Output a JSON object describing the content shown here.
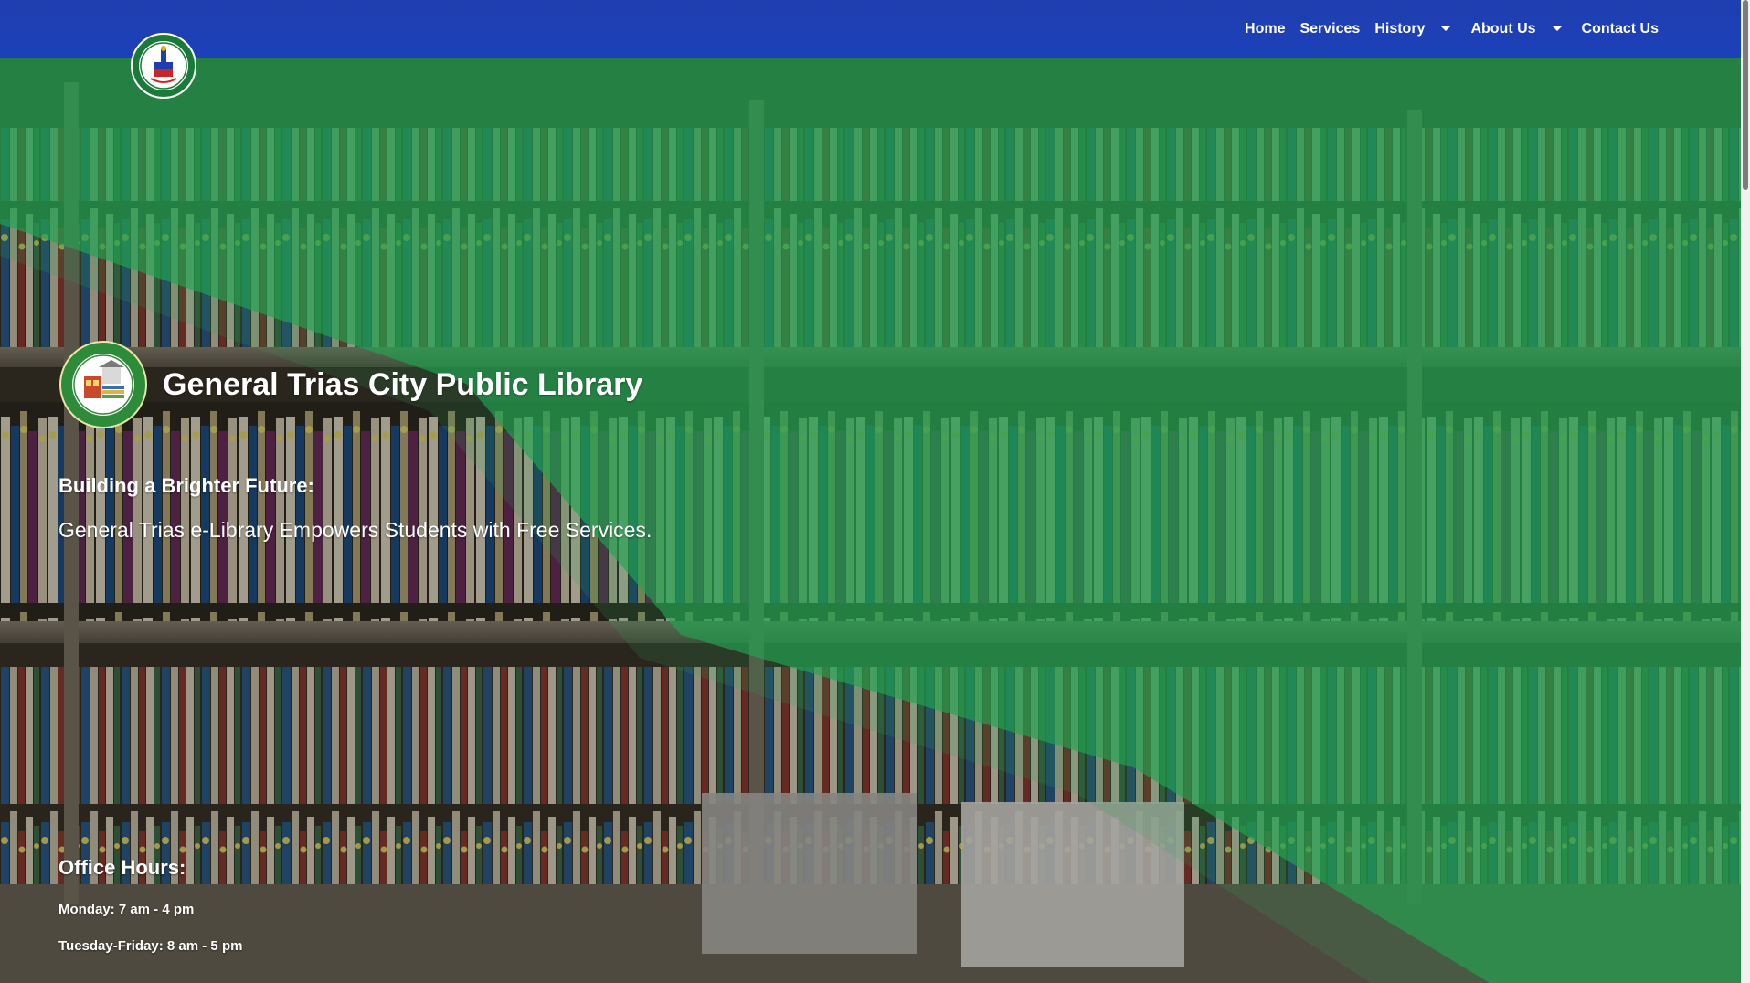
{
  "nav": {
    "items": [
      {
        "label": "Home",
        "dropdown": false
      },
      {
        "label": "Services",
        "dropdown": false
      },
      {
        "label": "History",
        "dropdown": true
      },
      {
        "label": "About Us",
        "dropdown": true
      },
      {
        "label": "Contact Us",
        "dropdown": false
      }
    ]
  },
  "header": {
    "seal_icon": "city-of-general-trias-seal-icon"
  },
  "hero": {
    "title": "General Trias City Public Library",
    "seal_icon": "city-public-library-seal-icon",
    "tagline_heading": "Building a Brighter Future:",
    "tagline_body": "General Trias e-Library Empowers Students with Free Services."
  },
  "office_hours": {
    "heading": "Office Hours:",
    "lines": [
      "Monday: 7 am - 4 pm",
      "Tuesday-Friday: 8 am - 5 pm"
    ]
  },
  "colors": {
    "nav_blue": "#1f3fb0",
    "overlay_green": "#1e9a4c",
    "text_white": "#ffffff"
  }
}
